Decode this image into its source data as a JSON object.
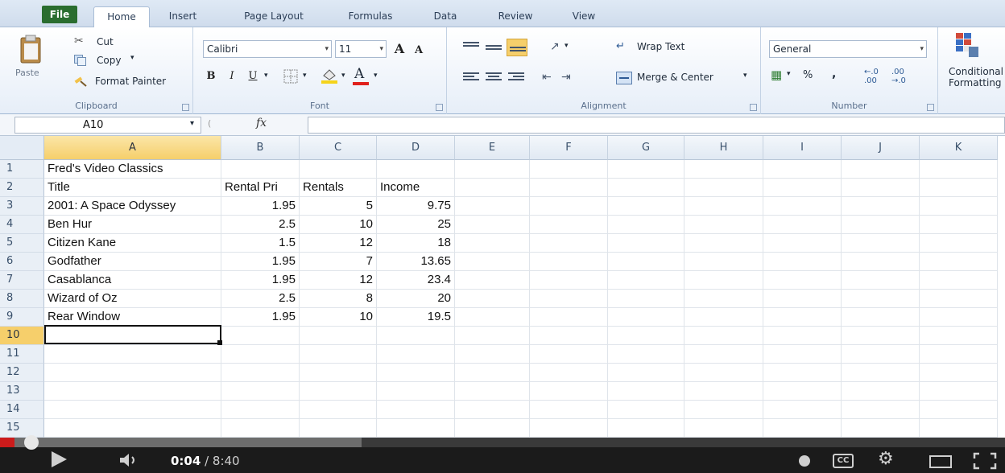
{
  "ribbon": {
    "tabs": [
      "File",
      "Home",
      "Insert",
      "Page Layout",
      "Formulas",
      "Data",
      "Review",
      "View"
    ],
    "clipboard": {
      "paste": "Paste",
      "cut": "Cut",
      "copy": "Copy",
      "format_painter": "Format Painter",
      "label": "Clipboard"
    },
    "font": {
      "name": "Calibri",
      "size": "11",
      "label": "Font",
      "bold": "B",
      "italic": "I",
      "underline": "U",
      "grow": "A",
      "shrink": "A"
    },
    "alignment": {
      "wrap": "Wrap Text",
      "merge": "Merge & Center",
      "label": "Alignment"
    },
    "number": {
      "format": "General",
      "percent": "%",
      "comma": ",",
      "label": "Number"
    },
    "conditional": "Conditional Formatting"
  },
  "formula_bar": {
    "name_box": "A10",
    "fx": "fx",
    "value": ""
  },
  "sheet": {
    "columns": [
      "A",
      "B",
      "C",
      "D",
      "E",
      "F",
      "G",
      "H",
      "I",
      "J",
      "K"
    ],
    "row_numbers": [
      "1",
      "2",
      "3",
      "4",
      "5",
      "6",
      "7",
      "8",
      "9",
      "10",
      "11",
      "12",
      "13",
      "14",
      "15"
    ],
    "rows": [
      [
        "Fred's Video Classics",
        "",
        "",
        ""
      ],
      [
        "Title",
        "Rental Pri",
        "Rentals",
        "Income"
      ],
      [
        "2001: A Space Odyssey",
        "1.95",
        "5",
        "9.75"
      ],
      [
        "Ben Hur",
        "2.5",
        "10",
        "25"
      ],
      [
        "Citizen Kane",
        "1.5",
        "12",
        "18"
      ],
      [
        "Godfather",
        "1.95",
        "7",
        "13.65"
      ],
      [
        "Casablanca",
        "1.95",
        "12",
        "23.4"
      ],
      [
        "Wizard of Oz",
        "2.5",
        "8",
        "20"
      ],
      [
        "Rear Window",
        "1.95",
        "10",
        "19.5"
      ]
    ],
    "active_cell": "A10"
  },
  "player": {
    "current": "0:04",
    "duration": "8:40",
    "separator": " / ",
    "progress": 0.008,
    "buffered": 0.36
  }
}
